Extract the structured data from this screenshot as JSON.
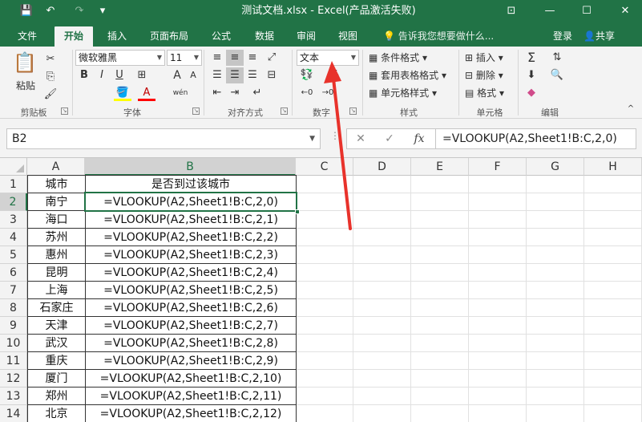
{
  "window": {
    "title": "测试文档.xlsx - Excel(产品激活失败)",
    "controls": [
      "⊡",
      "—",
      "☐",
      "✕"
    ]
  },
  "quick_access": {
    "save_icon": "💾",
    "undo_icon": "↶",
    "redo_icon": "↷",
    "customize_icon": "▾"
  },
  "tabs": [
    "文件",
    "开始",
    "插入",
    "页面布局",
    "公式",
    "数据",
    "审阅",
    "视图"
  ],
  "active_tab": "开始",
  "tell_me": "告诉我您想要做什么...",
  "login": "登录",
  "share": "共享",
  "ribbon": {
    "clipboard": {
      "paste": "粘贴",
      "group": "剪贴板"
    },
    "font": {
      "name": "微软雅黑",
      "size": "11",
      "bold": "B",
      "italic": "I",
      "underline": "U",
      "grow": "A",
      "shrink": "A",
      "font_color": "A",
      "phonetic": "wén",
      "group": "字体"
    },
    "alignment": {
      "group": "对齐方式"
    },
    "number": {
      "format": "文本",
      "percent": "%",
      "group": "数字"
    },
    "styles": {
      "conditional": "条件格式",
      "table": "套用表格格式",
      "cell": "单元格样式",
      "group": "样式"
    },
    "cells": {
      "insert": "插入",
      "delete": "删除",
      "format": "格式",
      "group": "单元格"
    },
    "editing": {
      "group": "编辑"
    }
  },
  "formula_bar": {
    "name_box": "B2",
    "cancel": "✕",
    "enter": "✓",
    "fx": "fx",
    "formula": "=VLOOKUP(A2,Sheet1!B:C,2,0)"
  },
  "sheet": {
    "columns": [
      "A",
      "B",
      "C",
      "D",
      "E",
      "F",
      "G",
      "H"
    ],
    "rows": [
      {
        "num": "1",
        "a": "城市",
        "b": "是否到过该城市"
      },
      {
        "num": "2",
        "a": "南宁",
        "b": "=VLOOKUP(A2,Sheet1!B:C,2,0)"
      },
      {
        "num": "3",
        "a": "海口",
        "b": "=VLOOKUP(A2,Sheet1!B:C,2,1)"
      },
      {
        "num": "4",
        "a": "苏州",
        "b": "=VLOOKUP(A2,Sheet1!B:C,2,2)"
      },
      {
        "num": "5",
        "a": "惠州",
        "b": "=VLOOKUP(A2,Sheet1!B:C,2,3)"
      },
      {
        "num": "6",
        "a": "昆明",
        "b": "=VLOOKUP(A2,Sheet1!B:C,2,4)"
      },
      {
        "num": "7",
        "a": "上海",
        "b": "=VLOOKUP(A2,Sheet1!B:C,2,5)"
      },
      {
        "num": "8",
        "a": "石家庄",
        "b": "=VLOOKUP(A2,Sheet1!B:C,2,6)"
      },
      {
        "num": "9",
        "a": "天津",
        "b": "=VLOOKUP(A2,Sheet1!B:C,2,7)"
      },
      {
        "num": "10",
        "a": "武汉",
        "b": "=VLOOKUP(A2,Sheet1!B:C,2,8)"
      },
      {
        "num": "11",
        "a": "重庆",
        "b": "=VLOOKUP(A2,Sheet1!B:C,2,9)"
      },
      {
        "num": "12",
        "a": "厦门",
        "b": "=VLOOKUP(A2,Sheet1!B:C,2,10)"
      },
      {
        "num": "13",
        "a": "郑州",
        "b": "=VLOOKUP(A2,Sheet1!B:C,2,11)"
      },
      {
        "num": "14",
        "a": "北京",
        "b": "=VLOOKUP(A2,Sheet1!B:C,2,12)"
      }
    ]
  },
  "colors": {
    "accent": "#217346",
    "annotation_arrow": "#e8322b"
  }
}
